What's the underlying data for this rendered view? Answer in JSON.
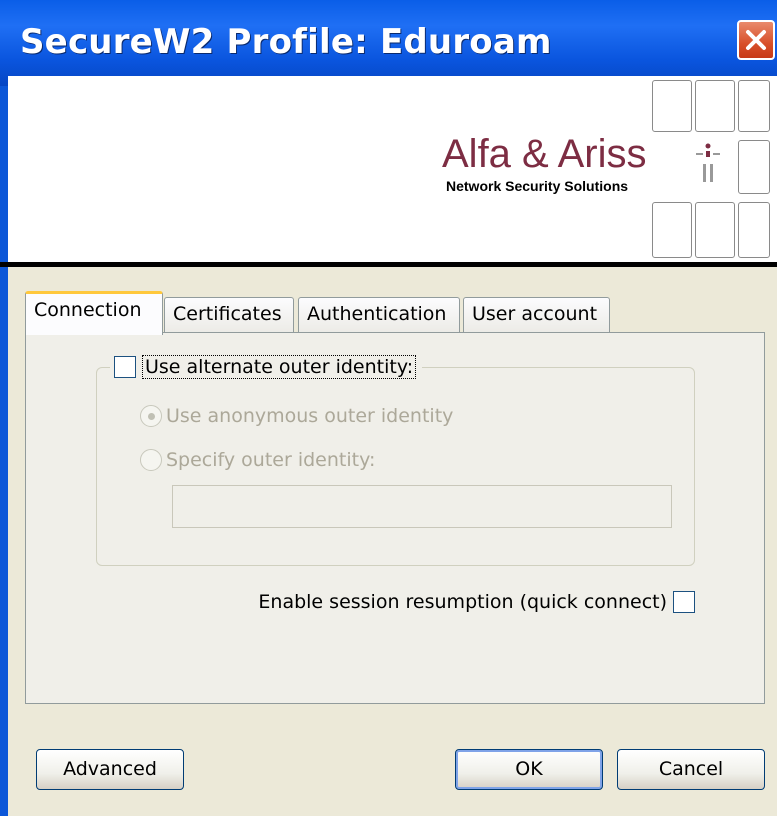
{
  "window": {
    "title": "SecureW2 Profile: Eduroam"
  },
  "banner": {
    "company_name": "Alfa & Ariss",
    "tagline": "Network Security Solutions"
  },
  "tabs": [
    {
      "label": "Connection",
      "active": true
    },
    {
      "label": "Certificates",
      "active": false
    },
    {
      "label": "Authentication",
      "active": false
    },
    {
      "label": "User account",
      "active": false
    }
  ],
  "connection": {
    "alternate_identity": {
      "label": "Use alternate outer identity:",
      "checked": false
    },
    "anonymous_option": {
      "label": "Use anonymous outer identity",
      "selected": true,
      "enabled": false
    },
    "specify_option": {
      "label": "Specify outer identity:",
      "selected": false,
      "enabled": false
    },
    "outer_identity_value": "",
    "session_resumption": {
      "label": "Enable session resumption (quick connect)",
      "checked": false
    }
  },
  "buttons": {
    "advanced": "Advanced",
    "ok": "OK",
    "cancel": "Cancel"
  },
  "colors": {
    "titlebar": "#0a5ee8",
    "close": "#d8502a",
    "brand": "#7d2d43",
    "tab_highlight": "#ffc83c",
    "dialog_bg": "#ece9d8"
  }
}
